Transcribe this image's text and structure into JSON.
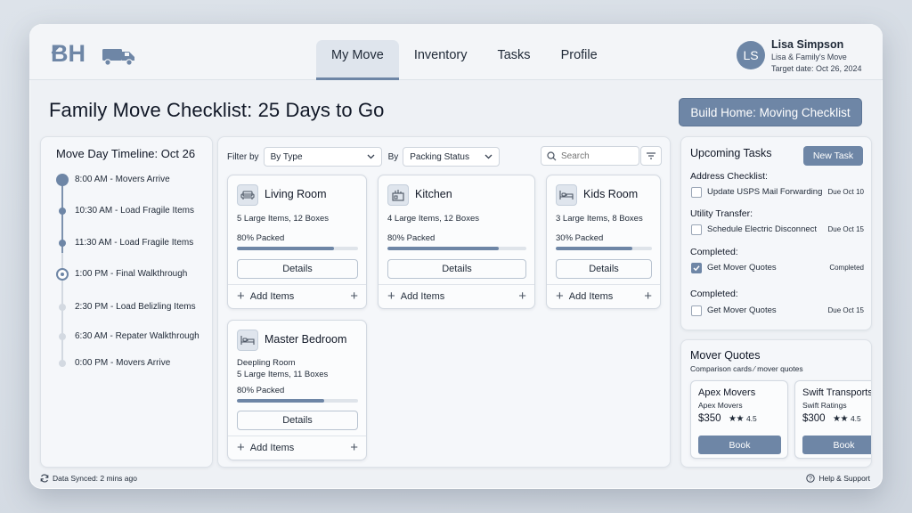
{
  "brand": {
    "logo_text": "BH",
    "accent": "#6e86a6"
  },
  "nav": {
    "tabs": [
      {
        "label": "My Move",
        "active": true
      },
      {
        "label": "Inventory",
        "active": false
      },
      {
        "label": "Tasks",
        "active": false
      },
      {
        "label": "Profile",
        "active": false
      }
    ]
  },
  "user": {
    "initials": "LS",
    "name": "Lisa Simpson",
    "move_name": "Lisa & Family's Move",
    "target_date": "Target date: Oct 26, 2024"
  },
  "page": {
    "title": "Family Move Checklist: 25 Days to Go",
    "build_button": "Build Home: Moving Checklist"
  },
  "timeline": {
    "title": "Move Day Timeline: Oct 26",
    "items": [
      {
        "label": "8:00 AM - Movers Arrive",
        "state": "done"
      },
      {
        "label": "10:30 AM - Load Fragile Items",
        "state": "done"
      },
      {
        "label": "11:30 AM - Load Fragile Items",
        "state": "done"
      },
      {
        "label": "1:00 PM - Final Walkthrough",
        "state": "current"
      },
      {
        "label": "2:30 PM - Load Belizling Items",
        "state": "upcoming"
      },
      {
        "label": "6:30 AM - Repater Walkthrough",
        "state": "upcoming"
      },
      {
        "label": "0:00 PM - Movers Arrive",
        "state": "upcoming"
      }
    ]
  },
  "board": {
    "filter_by_label": "Filter by",
    "filter_type": "By Type",
    "by_label": "By",
    "filter_status": "Packing Status",
    "search_placeholder": "Search",
    "details_label": "Details",
    "add_items_label": "Add Items",
    "rooms": [
      {
        "name": "Living Room",
        "subtitle": "",
        "items": "5 Large Items, 12 Boxes",
        "packed_label": "80% Packed",
        "packed": 80,
        "icon": "sofa-icon"
      },
      {
        "name": "Kitchen",
        "subtitle": "",
        "items": "4 Large Items, 12 Boxes",
        "packed_label": "80% Packed",
        "packed": 80,
        "icon": "kitchen-icon"
      },
      {
        "name": "Kids Room",
        "subtitle": "",
        "items": "3 Large Items, 8 Boxes",
        "packed_label": "30% Packed",
        "packed": 80,
        "icon": "bed-icon"
      },
      {
        "name": "Master Bedroom",
        "subtitle": "Deepling Room",
        "items": "5 Large Items, 11 Boxes",
        "packed_label": "80% Packed",
        "packed": 72,
        "icon": "bed-icon"
      }
    ]
  },
  "tasks": {
    "title": "Upcoming Tasks",
    "new_task_label": "New Task",
    "groups": [
      {
        "title": "Address Checklist:",
        "task": "Update USPS Mail Forwarding",
        "due": "Due Oct 10",
        "checked": false
      },
      {
        "title": "Utility Transfer:",
        "task": "Schedule Electric Disconnect",
        "due": "Due Oct 15",
        "checked": false
      },
      {
        "title": "Completed:",
        "task": "Get Mover Quotes",
        "due": "Completed",
        "checked": true
      },
      {
        "title": "Completed:",
        "task": "Get Mover Quotes",
        "due": "Due Oct 15",
        "checked": false
      }
    ]
  },
  "quotes": {
    "title": "Mover Quotes",
    "subtitle": "Comparison cards ⁄ mover quotes",
    "book_label": "Book",
    "cards": [
      {
        "name": "Apex Movers",
        "sub": "Apex Movers",
        "price": "$350",
        "stars": 2,
        "rating": "4.5"
      },
      {
        "name": "Swift Transports",
        "sub": "Swift Ratings",
        "price": "$300",
        "stars": 2,
        "rating": "4.5"
      }
    ]
  },
  "footer": {
    "sync": "Data Synced: 2 mins ago",
    "help": "Help & Support"
  }
}
